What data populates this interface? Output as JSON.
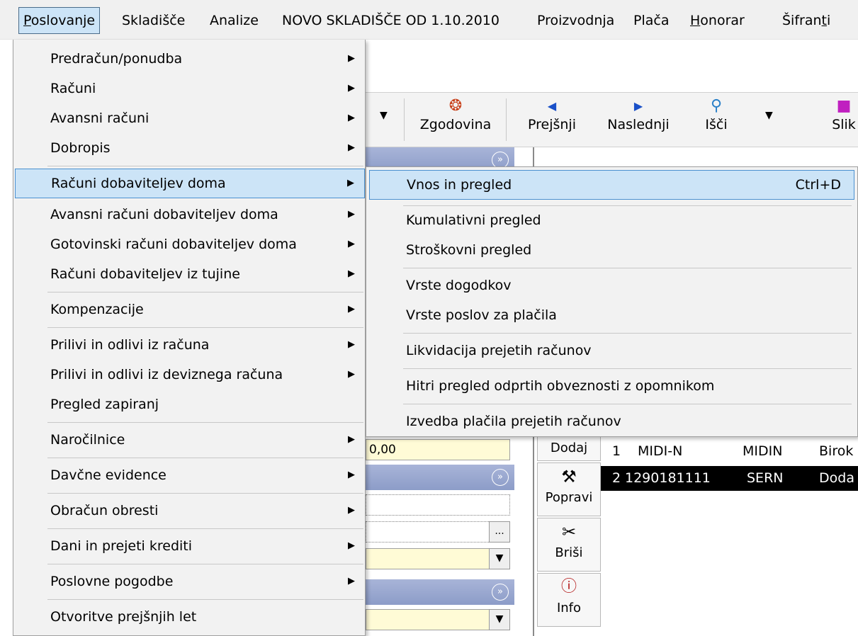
{
  "menubar": {
    "items": [
      {
        "label": "Poslovanje",
        "mnemonic": "P",
        "rest": "oslovanje"
      },
      {
        "label": "Skladišče"
      },
      {
        "label": "Analize"
      },
      {
        "label": "NOVO SKLADIŠČE OD 1.10.2010"
      },
      {
        "label": "Proizvodnja"
      },
      {
        "label": "Plača"
      },
      {
        "label": "Honorar",
        "mnemonic": "H",
        "rest": "onorar"
      },
      {
        "label": "Šifranti",
        "pre": "Šifran",
        "mnemonic": "t",
        "rest": "i"
      }
    ]
  },
  "toolbar": {
    "history": "Zgodovina",
    "prev": "Prejšnji",
    "next": "Naslednji",
    "search": "Išči",
    "pictures": "Slik"
  },
  "menu": {
    "items": [
      {
        "label": "Predračun/ponudba",
        "arrow": "▶"
      },
      {
        "label": "Računi",
        "arrow": "▶"
      },
      {
        "label": "Avansni računi",
        "arrow": "▶"
      },
      {
        "label": "Dobropis",
        "arrow": "▶"
      },
      {
        "label": "Računi dobaviteljev doma",
        "arrow": "▶"
      },
      {
        "label": "Avansni računi dobaviteljev doma",
        "arrow": "▶"
      },
      {
        "label": "Gotovinski računi dobaviteljev doma",
        "arrow": "▶"
      },
      {
        "label": "Računi dobaviteljev iz tujine",
        "arrow": "▶"
      },
      {
        "label": "Kompenzacije",
        "arrow": "▶"
      },
      {
        "label": "Prilivi in odlivi iz računa",
        "arrow": "▶"
      },
      {
        "label": "Prilivi in odlivi iz deviznega računa",
        "arrow": "▶"
      },
      {
        "label": "Pregled zapiranj",
        "arrow": ""
      },
      {
        "label": "Naročilnice",
        "arrow": "▶"
      },
      {
        "label": "Davčne evidence",
        "arrow": "▶"
      },
      {
        "label": "Obračun obresti",
        "arrow": "▶"
      },
      {
        "label": "Dani in prejeti krediti",
        "arrow": "▶"
      },
      {
        "label": "Poslovne pogodbe",
        "arrow": "▶"
      },
      {
        "label": "Otvoritve prejšnjih let",
        "arrow": ""
      }
    ]
  },
  "submenu": {
    "items": [
      {
        "label": "Vnos in pregled",
        "shortcut": "Ctrl+D"
      },
      {
        "label": "Kumulativni pregled"
      },
      {
        "label": "Stroškovni pregled"
      },
      {
        "label": "Vrste dogodkov"
      },
      {
        "label": "Vrste poslov za plačila"
      },
      {
        "label": "Likvidacija prejetih računov"
      },
      {
        "label": "Hitri pregled odprtih obveznosti z opomnikom"
      },
      {
        "label": "Izvedba plačila prejetih računov"
      }
    ]
  },
  "form": {
    "amount": "0,00",
    "ellipsis": "...",
    "chevron": "»"
  },
  "side_buttons": {
    "add": "Dodaj",
    "edit": "Popravi",
    "delete": "Briši",
    "info": "Info"
  },
  "grid": {
    "rows": [
      {
        "num": "1",
        "code": "MIDI-N",
        "short": "MIDIN",
        "desc": "Birok"
      },
      {
        "num": "2",
        "code": "1290181111",
        "short": "SERN",
        "desc": "Doda"
      }
    ]
  },
  "colors": {
    "menu_bg": "#f2f2f2",
    "highlight": "#cce4f7",
    "highlight_border": "#4a90d0",
    "field_yellow": "#fffbd6",
    "band_blue": "#8c9cc8"
  }
}
